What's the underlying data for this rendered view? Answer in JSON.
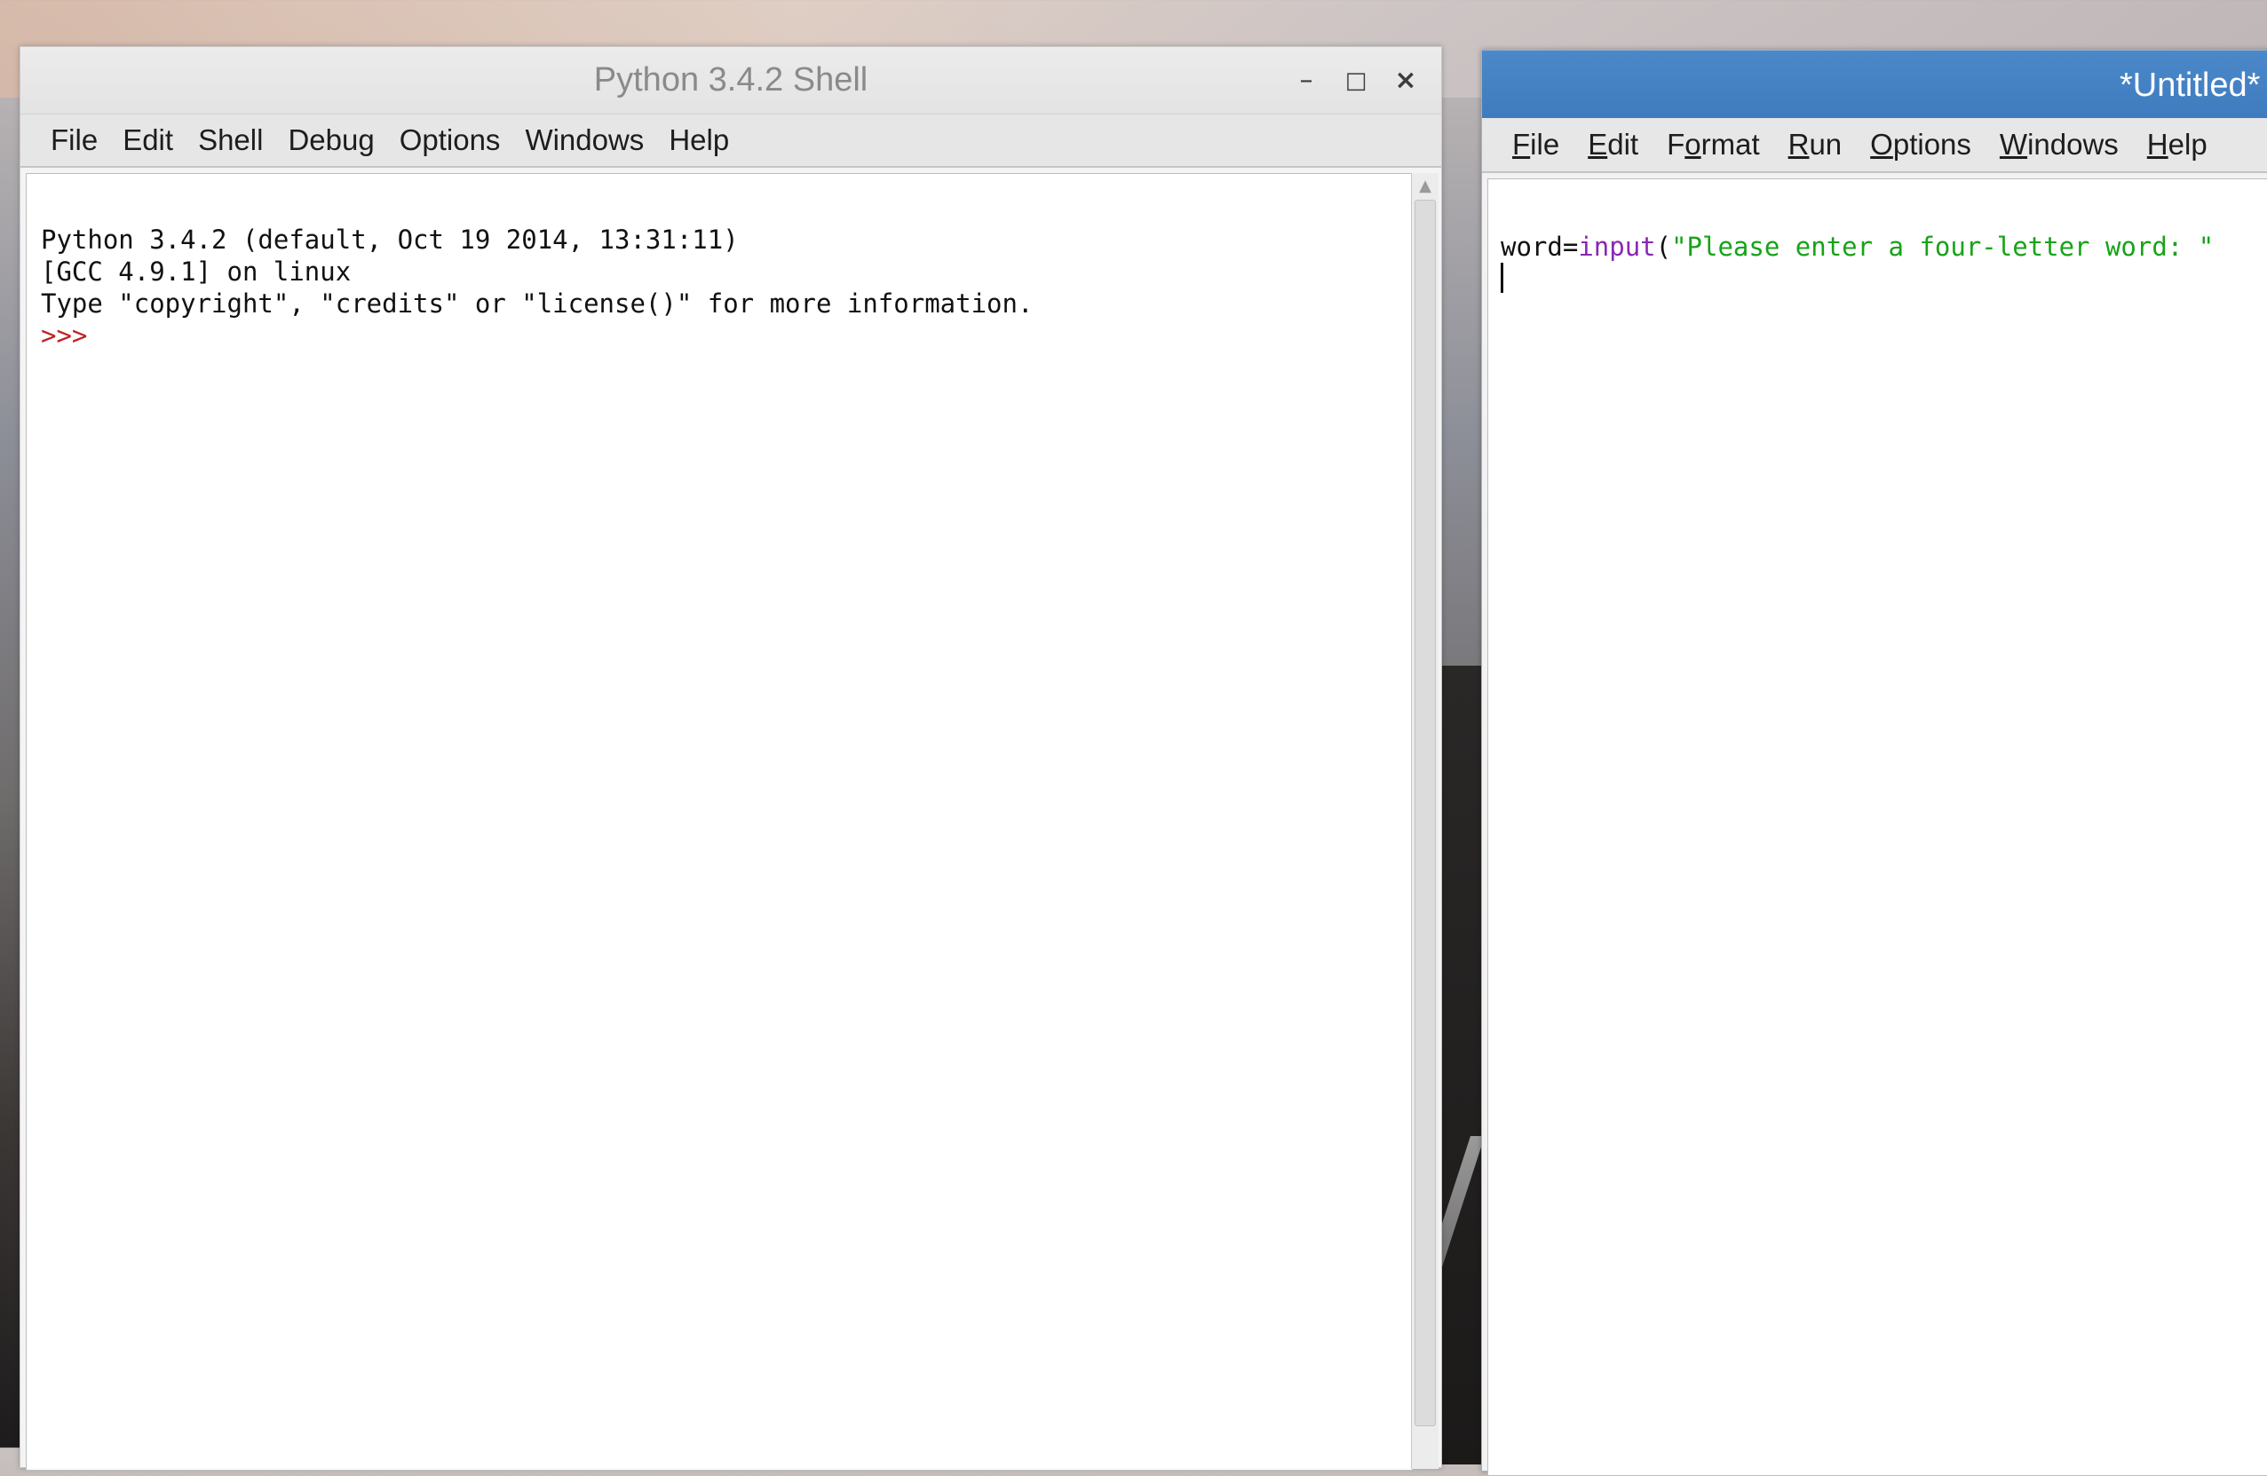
{
  "shell_window": {
    "title": "Python 3.4.2 Shell",
    "controls": {
      "minimize": "–",
      "maximize": "□",
      "close": "×"
    },
    "menu": [
      "File",
      "Edit",
      "Shell",
      "Debug",
      "Options",
      "Windows",
      "Help"
    ],
    "lines": [
      "Python 3.4.2 (default, Oct 19 2014, 13:31:11)",
      "[GCC 4.9.1] on linux",
      "Type \"copyright\", \"credits\" or \"license()\" for more information."
    ],
    "prompt": ">>>"
  },
  "editor_window": {
    "title": "*Untitled*",
    "menu": [
      {
        "label": "File",
        "mnemonic_first": "F",
        "rest": "ile"
      },
      {
        "label": "Edit",
        "mnemonic_first": "E",
        "rest": "dit"
      },
      {
        "label": "Format",
        "pre": "F",
        "mnemonic": "o",
        "post": "rmat"
      },
      {
        "label": "Run",
        "mnemonic_first": "R",
        "rest": "un"
      },
      {
        "label": "Options",
        "mnemonic_first": "O",
        "rest": "ptions"
      },
      {
        "label": "Windows",
        "mnemonic_first": "W",
        "rest": "indows"
      },
      {
        "label": "Help",
        "mnemonic_first": "H",
        "rest": "elp"
      }
    ],
    "code": {
      "var": "word=",
      "func": "input",
      "paren": "(",
      "string": "\"Please enter a four-letter word: \""
    }
  },
  "colors": {
    "prompt": "#c22020",
    "builtin": "#8a28b3",
    "string": "#17a317",
    "editor_titlebar": "#4a88c9"
  }
}
